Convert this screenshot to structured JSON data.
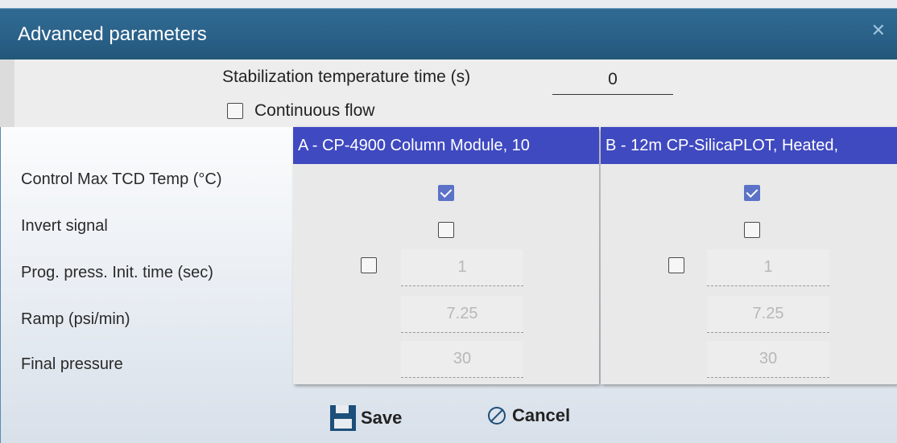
{
  "window": {
    "title": "Advanced parameters",
    "close_glyph": "✕"
  },
  "top": {
    "stabilization_label": "Stabilization temperature time (s)",
    "stabilization_value": "0",
    "continuous_flow_label": "Continuous flow",
    "continuous_flow_checked": false
  },
  "rows": {
    "control_max_tcd": "Control Max TCD Temp (°C)",
    "invert_signal": "Invert signal",
    "prog_press_init": "Prog. press. Init. time (sec)",
    "ramp": "Ramp (psi/min)",
    "final_pressure": "Final pressure"
  },
  "columns": [
    {
      "header": "A - CP-4900 Column Module, 10",
      "control_max_checked": true,
      "invert_checked": false,
      "prog_checked": false,
      "init_time": "1",
      "ramp": "7.25",
      "final_pressure": "30"
    },
    {
      "header": "B - 12m CP-SilicaPLOT, Heated, ",
      "control_max_checked": true,
      "invert_checked": false,
      "prog_checked": false,
      "init_time": "1",
      "ramp": "7.25",
      "final_pressure": "30"
    }
  ],
  "footer": {
    "save_label": "Save",
    "cancel_label": "Cancel"
  },
  "icons": {
    "save": "floppy-disk-icon",
    "cancel": "cancel-circle-icon",
    "close": "close-icon"
  },
  "colors": {
    "titlebar": "#2a6189",
    "column_header": "#3f49c0",
    "checkbox_checked": "#5b72c8"
  }
}
